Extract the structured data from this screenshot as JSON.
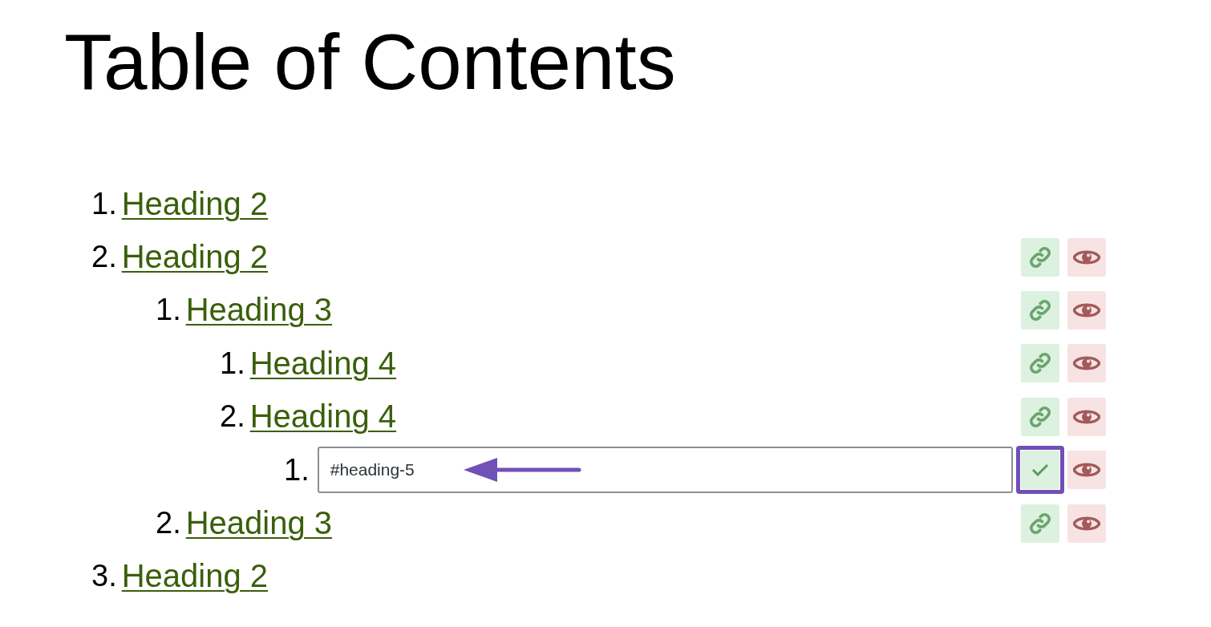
{
  "title": "Table of Contents",
  "items": [
    {
      "number": "1.",
      "kind": "link",
      "label": "Heading 2",
      "actions": false
    },
    {
      "number": "2.",
      "kind": "link",
      "label": "Heading 2",
      "actions": true,
      "children": [
        {
          "number": "1.",
          "kind": "link",
          "label": "Heading 3",
          "actions": true,
          "children": [
            {
              "number": "1.",
              "kind": "link",
              "label": "Heading 4",
              "actions": true
            },
            {
              "number": "2.",
              "kind": "link",
              "label": "Heading 4",
              "actions": true,
              "children": [
                {
                  "number": "1.",
                  "kind": "edit",
                  "value": "#heading-5",
                  "actions": true,
                  "highlighted": true,
                  "pointer_arrow": true
                }
              ]
            }
          ]
        },
        {
          "number": "2.",
          "kind": "link",
          "label": "Heading 3",
          "actions": true
        }
      ]
    },
    {
      "number": "3.",
      "kind": "link",
      "label": "Heading 2",
      "actions": false
    }
  ]
}
